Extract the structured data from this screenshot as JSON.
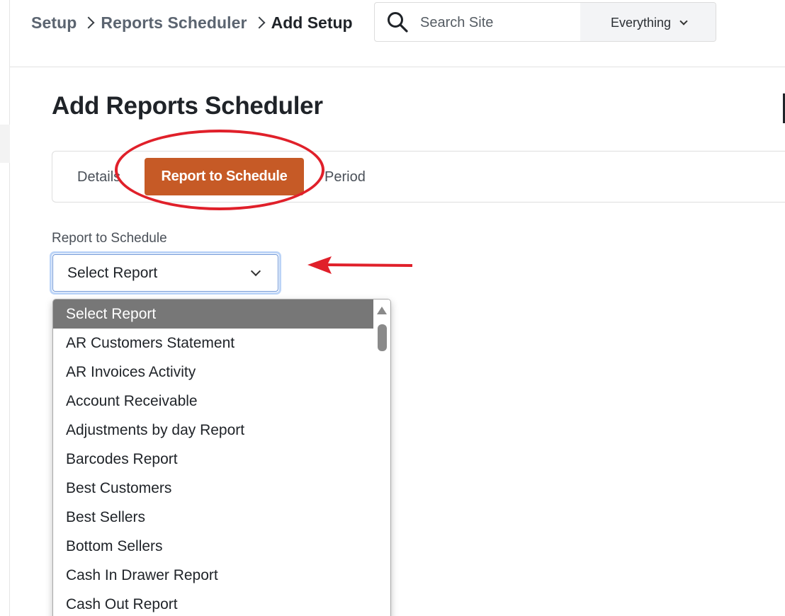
{
  "breadcrumb": {
    "items": [
      "Setup",
      "Reports Scheduler"
    ],
    "current": "Add Setup"
  },
  "search": {
    "placeholder": "Search Site",
    "scope": "Everything"
  },
  "page": {
    "title": "Add Reports Scheduler"
  },
  "tabs": {
    "items": [
      "Details",
      "Report to Schedule",
      "Period"
    ],
    "active": "Report to Schedule"
  },
  "form": {
    "report_label": "Report to Schedule",
    "report_value": "Select Report"
  },
  "dropdown": {
    "options": [
      "Select Report",
      "AR Customers Statement",
      "AR Invoices Activity",
      "Account Receivable",
      "Adjustments by day Report",
      "Barcodes Report",
      "Best Customers",
      "Best Sellers",
      "Bottom Sellers",
      "Cash In Drawer Report",
      "Cash Out Report"
    ],
    "highlighted": "Select Report"
  },
  "colors": {
    "accent": "#c65a26",
    "annotation": "#e0202a",
    "focus_ring": "#bcd4f7",
    "option_highlight": "#777777"
  },
  "icons": {
    "search": "search-icon",
    "breadcrumb_separator": "chevron-right-icon",
    "scope_dropdown": "chevron-down-icon",
    "select_dropdown": "chevron-down-icon",
    "scroll_up": "triangle-up-icon"
  }
}
